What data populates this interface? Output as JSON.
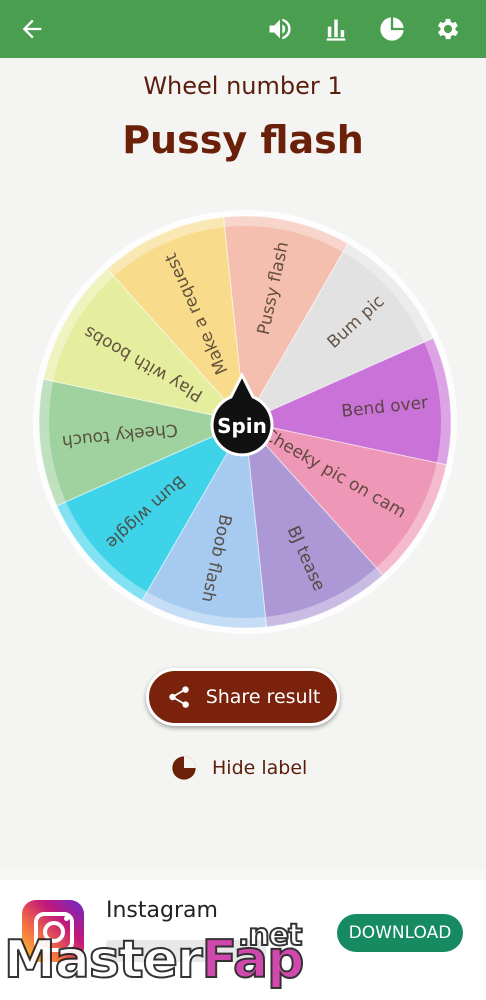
{
  "header": {
    "icons": [
      "back-arrow-icon",
      "volume-icon",
      "stats-icon",
      "pie-chart-icon",
      "gear-icon"
    ]
  },
  "wheel": {
    "number_label": "Wheel number 1",
    "result": "Pussy flash",
    "spin_label": "Spin",
    "segments": [
      {
        "label": "Pussy flash",
        "color": "#f5bfb0"
      },
      {
        "label": "Bum pic",
        "color": "#e2e2e2"
      },
      {
        "label": "Bend over",
        "color": "#c973d8"
      },
      {
        "label": "Cheeky pic on cam",
        "color": "#ef97b6"
      },
      {
        "label": "BJ tease",
        "color": "#ad98d6"
      },
      {
        "label": "Boob flash",
        "color": "#a7cbf0"
      },
      {
        "label": "Bum wiggle",
        "color": "#3fd3ea"
      },
      {
        "label": "Cheeky touch",
        "color": "#9fd29f"
      },
      {
        "label": "Play with boobs",
        "color": "#e5ed9f"
      },
      {
        "label": "Make a request",
        "color": "#f8dc8c"
      }
    ]
  },
  "actions": {
    "share_label": "Share result",
    "hide_label": "Hide label"
  },
  "ad": {
    "app_name": "Instagram",
    "download_label": "DOWNLOAD"
  },
  "watermark": {
    "part1": "Master",
    "part2": "Fap",
    "part3": ".net"
  },
  "colors": {
    "header_bg": "#4a9e4f",
    "accent": "#7a220b",
    "download_bg": "#168a60"
  }
}
